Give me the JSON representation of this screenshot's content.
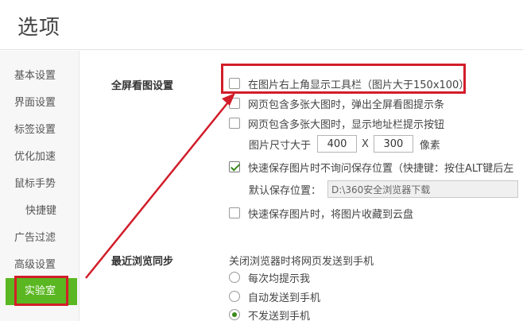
{
  "header": {
    "title": "选项"
  },
  "sidebar": {
    "items": [
      {
        "label": "基本设置"
      },
      {
        "label": "界面设置"
      },
      {
        "label": "标签设置"
      },
      {
        "label": "优化加速"
      },
      {
        "label": "鼠标手势"
      },
      {
        "label": "快捷键"
      },
      {
        "label": "广告过滤"
      },
      {
        "label": "高级设置"
      },
      {
        "label": "实验室",
        "active": true
      }
    ]
  },
  "fullscreen": {
    "section_title": "全屏看图设置",
    "opt_toolbar": "在图片右上角显示工具栏（图片大于150x100）",
    "opt_prompt": "网页包含多张大图时，弹出全屏看图提示条",
    "opt_address": "网页包含多张大图时，显示地址栏提示按钮",
    "size_label": "图片尺寸大于",
    "width_value": "400",
    "x_sep": "X",
    "height_value": "300",
    "unit": "像素",
    "opt_quick_save": "快速保存图片时不询问保存位置（快捷键：按住ALT键后左",
    "default_path_label": "默认保存位置：",
    "default_path_value": "D:\\360安全浏览器下载",
    "opt_cloud": "快速保存图片时，将图片收藏到云盘"
  },
  "sync": {
    "section_title": "最近浏览同步",
    "desc": "关闭浏览器时将网页发送到手机",
    "radio_prompt": "每次均提示我",
    "radio_auto": "自动发送到手机",
    "radio_none": "不发送到手机"
  },
  "colors": {
    "accent": "#5ab721",
    "annotation": "#d21e2a"
  }
}
